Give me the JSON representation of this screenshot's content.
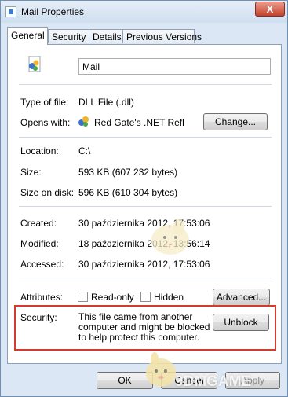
{
  "window": {
    "title": "Mail Properties",
    "close_label": "X"
  },
  "tabs": [
    {
      "label": "General",
      "active": true
    },
    {
      "label": "Security",
      "active": false
    },
    {
      "label": "Details",
      "active": false
    },
    {
      "label": "Previous Versions",
      "active": false
    }
  ],
  "general": {
    "file_icon": "dll-file-icon",
    "name_value": "Mail",
    "type_label": "Type of file:",
    "type_value": "DLL File (.dll)",
    "opens_label": "Opens with:",
    "opens_value": "Red Gate's .NET Refle",
    "change_label": "Change...",
    "location_label": "Location:",
    "location_value": "C:\\",
    "size_label": "Size:",
    "size_value": "593 KB (607 232 bytes)",
    "size_disk_label": "Size on disk:",
    "size_disk_value": "596 KB (610 304 bytes)",
    "created_label": "Created:",
    "created_value": "30 października 2012, 17:53:06",
    "modified_label": "Modified:",
    "modified_value": "18 października 2012, 13:56:14",
    "accessed_label": "Accessed:",
    "accessed_value": "30 października 2012, 17:53:06",
    "attributes_label": "Attributes:",
    "readonly_label": "Read-only",
    "readonly_checked": false,
    "hidden_label": "Hidden",
    "hidden_checked": false,
    "advanced_label": "Advanced...",
    "security_label": "Security:",
    "security_text": "This file came from another computer and might be blocked to help protect this computer.",
    "unblock_label": "Unblock",
    "highlight_color": "#d73a2d"
  },
  "footer": {
    "ok_label": "OK",
    "cancel_label": "Cancel",
    "apply_label": "Apply"
  },
  "watermark": {
    "text": "9DMGAME"
  }
}
